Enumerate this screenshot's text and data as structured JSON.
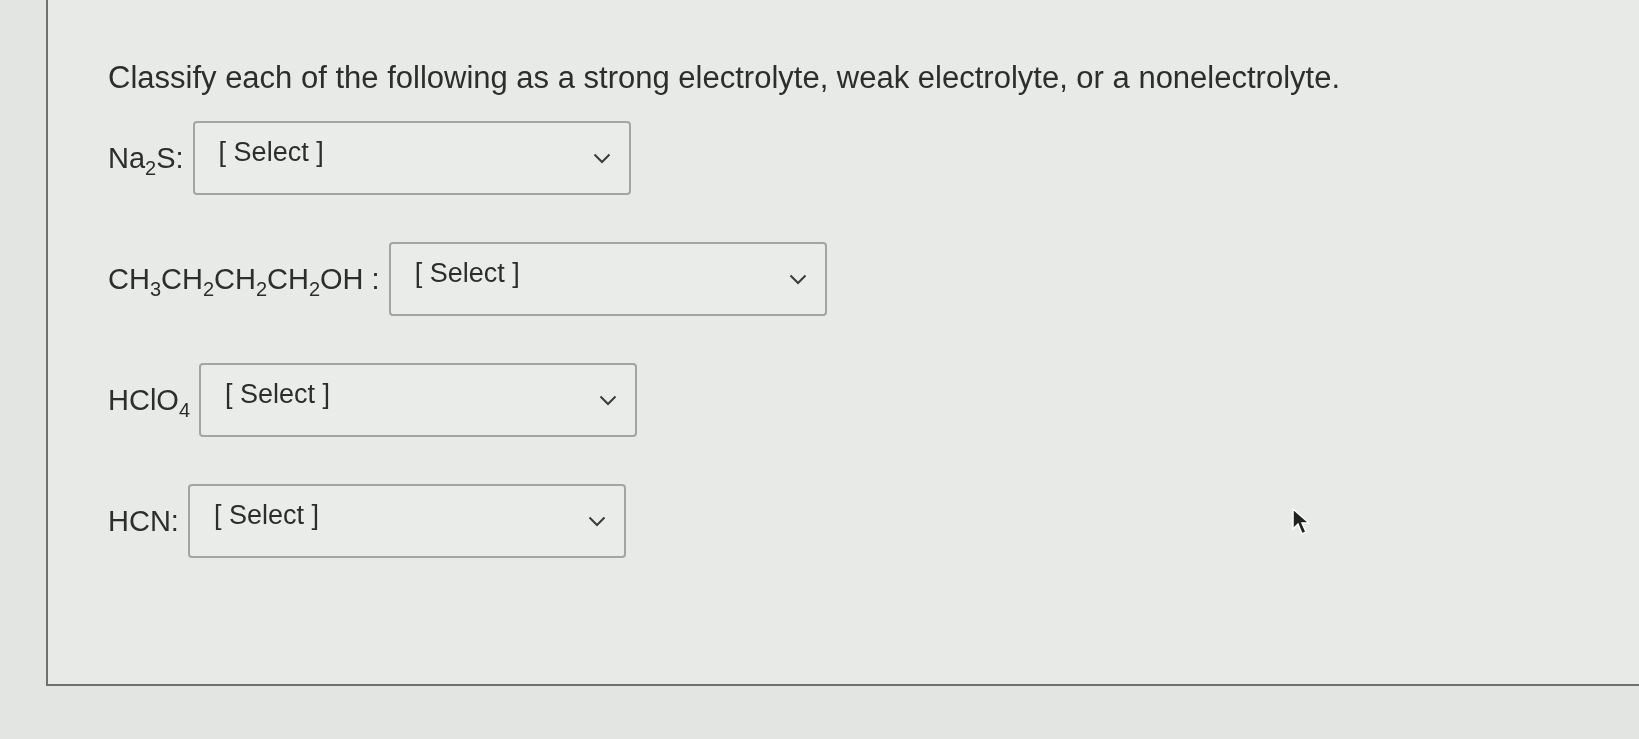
{
  "question": {
    "prompt": "Classify each of the following as a strong electrolyte, weak electrolyte, or a nonelectrolyte."
  },
  "items": [
    {
      "label": "Na$_{2}$S:",
      "select": {
        "value": "[ Select ]"
      }
    },
    {
      "label": "CH$_{3}$CH$_{2}$CH$_{2}$CH$_{2}$OH :",
      "select": {
        "value": "[ Select ]"
      }
    },
    {
      "label": "HClO$_{4}$",
      "select": {
        "value": "[ Select ]"
      }
    },
    {
      "label": "HCN:",
      "select": {
        "value": "[ Select ]"
      }
    }
  ]
}
